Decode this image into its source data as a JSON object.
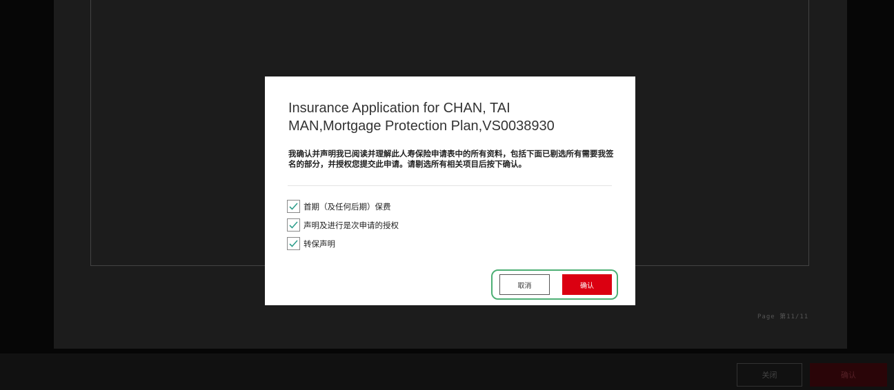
{
  "background": {
    "page_indicator": "Page 第11/11",
    "bottom_bar": {
      "close_label": "关闭",
      "confirm_label": "确认"
    }
  },
  "modal": {
    "title": "Insurance Application for CHAN, TAI MAN,Mortgage Protection Plan,VS0038930",
    "description": "我确认并声明我已阅读并理解此人寿保险申请表中的所有资料，包括下面已剔选所有需要我签名的部分，并授权您提交此申请。请剔选所有相关项目后按下确认。",
    "checkboxes": [
      {
        "label": "首期（及任何后期）保费",
        "checked": true
      },
      {
        "label": "声明及进行是次申请的授权",
        "checked": true
      },
      {
        "label": "转保声明",
        "checked": true
      }
    ],
    "cancel_label": "取消",
    "confirm_label": "确认"
  },
  "colors": {
    "accent_red": "#db0011",
    "check_color": "#2e9e8c",
    "highlight_green": "#4caf74"
  }
}
